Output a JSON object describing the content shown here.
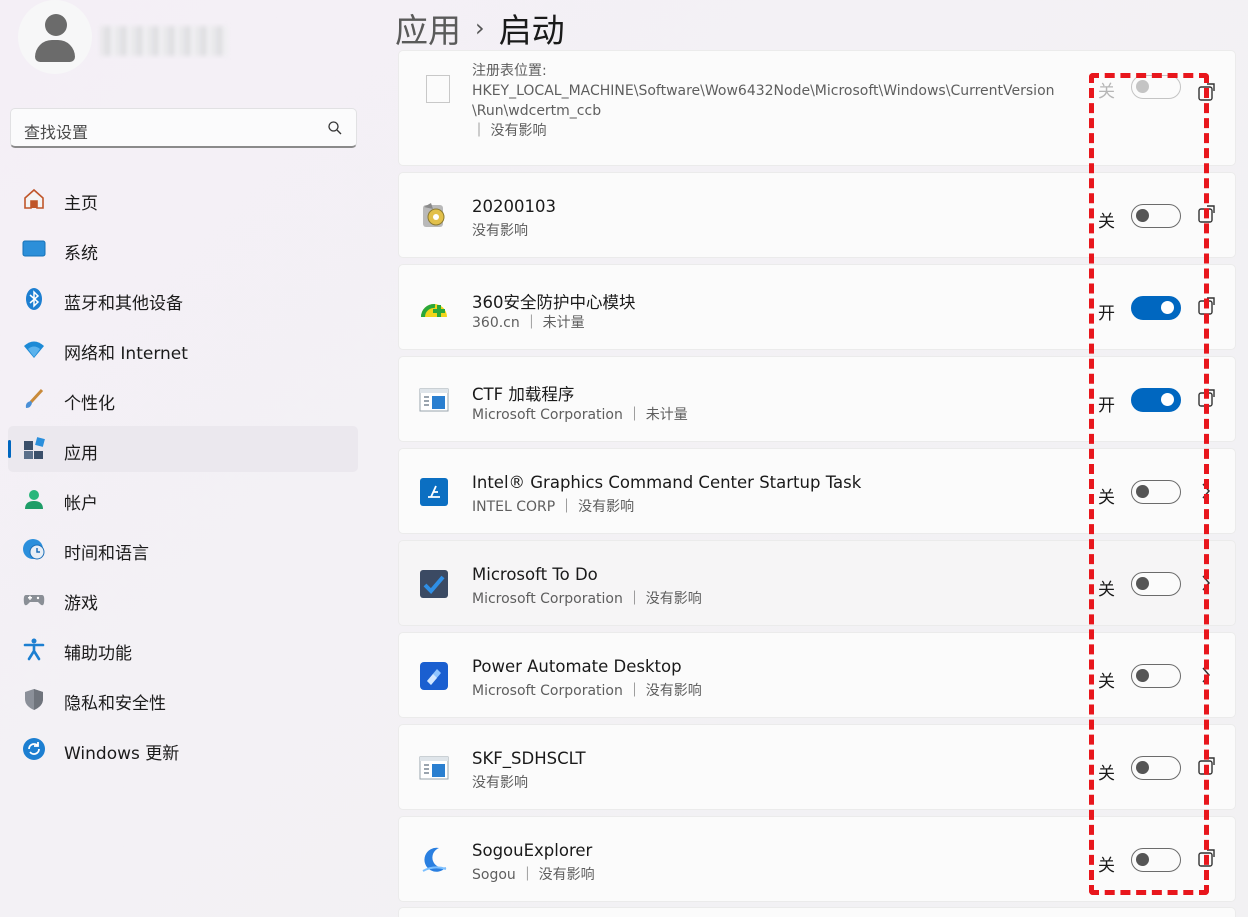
{
  "header": {
    "parent": "应用",
    "separator": "›",
    "title": "启动"
  },
  "search": {
    "placeholder": "查找设置"
  },
  "nav": [
    {
      "label": "主页",
      "icon": "home-icon"
    },
    {
      "label": "系统",
      "icon": "system-icon"
    },
    {
      "label": "蓝牙和其他设备",
      "icon": "bluetooth-icon"
    },
    {
      "label": "网络和 Internet",
      "icon": "wifi-icon"
    },
    {
      "label": "个性化",
      "icon": "brush-icon"
    },
    {
      "label": "应用",
      "icon": "apps-icon",
      "active": true
    },
    {
      "label": "帐户",
      "icon": "account-icon"
    },
    {
      "label": "时间和语言",
      "icon": "clock-globe-icon"
    },
    {
      "label": "游戏",
      "icon": "gamepad-icon"
    },
    {
      "label": "辅助功能",
      "icon": "accessibility-icon"
    },
    {
      "label": "隐私和安全性",
      "icon": "shield-icon"
    },
    {
      "label": "Windows 更新",
      "icon": "update-icon"
    }
  ],
  "first_row": {
    "path_lines": [
      "注册表位置:",
      "HKEY_LOCAL_MACHINE\\Software\\Wow6432Node\\Microsoft\\Windows\\CurrentVersion",
      "\\Run\\wdcertm_ccb",
      "｜ 没有影响"
    ],
    "state": "关",
    "on": false
  },
  "apps": [
    {
      "name": "20200103",
      "sub": "没有影响",
      "state": "关",
      "on": false,
      "icon": "gear-app-icon",
      "tail": "open-icon"
    },
    {
      "name": "360安全防护中心模块",
      "sub": "360.cn ｜ 未计量",
      "state": "开",
      "on": true,
      "icon": "360-icon",
      "tail": "open-icon"
    },
    {
      "name": "CTF 加载程序",
      "sub": "Microsoft Corporation ｜ 未计量",
      "state": "开",
      "on": true,
      "icon": "window-app-icon",
      "tail": "open-icon"
    },
    {
      "name": "Intel® Graphics Command Center Startup Task",
      "sub": "INTEL CORP ｜ 没有影响",
      "state": "关",
      "on": false,
      "icon": "intel-icon",
      "tail": "chevron-right-icon"
    },
    {
      "name": "Microsoft To Do",
      "sub": "Microsoft Corporation ｜ 没有影响",
      "state": "关",
      "on": false,
      "icon": "todo-icon",
      "tail": "chevron-right-icon"
    },
    {
      "name": "Power Automate Desktop",
      "sub": "Microsoft Corporation ｜ 没有影响",
      "state": "关",
      "on": false,
      "icon": "power-automate-icon",
      "tail": "chevron-right-icon"
    },
    {
      "name": "SKF_SDHSCLT",
      "sub": "没有影响",
      "state": "关",
      "on": false,
      "icon": "window-app-icon",
      "tail": "open-icon"
    },
    {
      "name": "SogouExplorer",
      "sub": "Sogou ｜ 没有影响",
      "state": "关",
      "on": false,
      "icon": "sogou-icon",
      "tail": "open-icon"
    }
  ],
  "colors": {
    "accent": "#0067c0",
    "highlight": "#e8161c"
  }
}
